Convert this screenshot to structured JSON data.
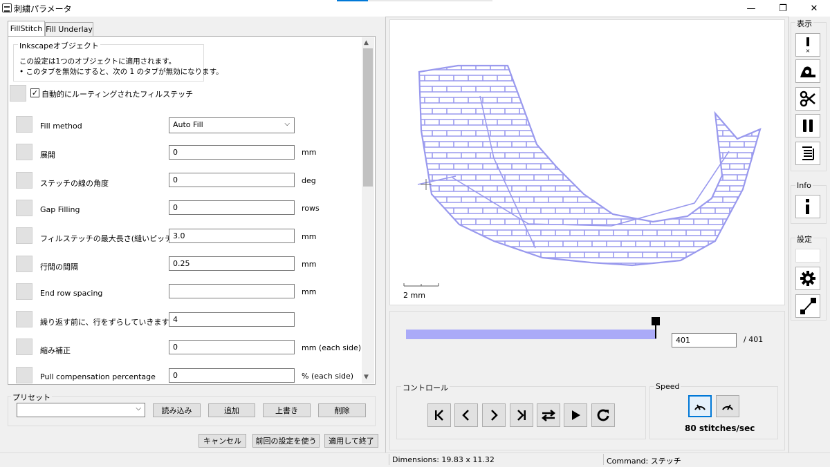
{
  "window": {
    "title": "刺繍パラメータ",
    "minimize": "—",
    "maximize": "❐",
    "close": "✕"
  },
  "tabs": [
    {
      "label": "FillStitch"
    },
    {
      "label": "Fill Underlay"
    }
  ],
  "info_group": {
    "title": "Inkscapeオブジェクト",
    "line1": "この設定は1つのオブジェクトに適用されます。",
    "line2": "• このタブを無効にすると、次の 1 のタブが無効になります。"
  },
  "auto_fill_checkbox": {
    "label": "自動的にルーティングされたフィルステッチ",
    "checked": true
  },
  "params": [
    {
      "label": "Fill method",
      "value": "Auto Fill",
      "unit": "",
      "type": "select"
    },
    {
      "label": "展開",
      "value": "0",
      "unit": "mm"
    },
    {
      "label": "ステッチの線の角度",
      "value": "0",
      "unit": "deg"
    },
    {
      "label": "Gap Filling",
      "value": "0",
      "unit": "rows"
    },
    {
      "label": "フィルステッチの最大長さ(縫いピッチ)",
      "value": "3.0",
      "unit": "mm"
    },
    {
      "label": "行間の間隔",
      "value": "0.25",
      "unit": "mm"
    },
    {
      "label": "End row spacing",
      "value": "",
      "unit": "mm"
    },
    {
      "label": "繰り返す前に、行をずらしていきます",
      "value": "4",
      "unit": ""
    },
    {
      "label": "縮み補正",
      "value": "0",
      "unit": "mm (each side)"
    },
    {
      "label": "Pull compensation percentage",
      "value": "0",
      "unit": "% (each side)"
    }
  ],
  "preset": {
    "title": "プリセット",
    "select_value": "",
    "load": "読み込み",
    "add": "追加",
    "overwrite": "上書き",
    "delete": "削除"
  },
  "footer": {
    "cancel": "キャンセル",
    "use_last": "前回の設定を使う",
    "apply": "適用して終了"
  },
  "preview": {
    "scale_label": "2 mm",
    "current_stitch": "401",
    "total_label": "/ 401",
    "progress": 1.0,
    "controls_title": "コントロール",
    "speed_title": "Speed",
    "speed_value": "80 stitches/sec",
    "stitch_color": "#9999ee"
  },
  "right_toolbar": {
    "display_label": "表示",
    "info_label": "Info",
    "settings_label": "設定"
  },
  "status": {
    "dimensions": "Dimensions: 19.83 x 11.32",
    "command": "Command: ステッチ"
  }
}
